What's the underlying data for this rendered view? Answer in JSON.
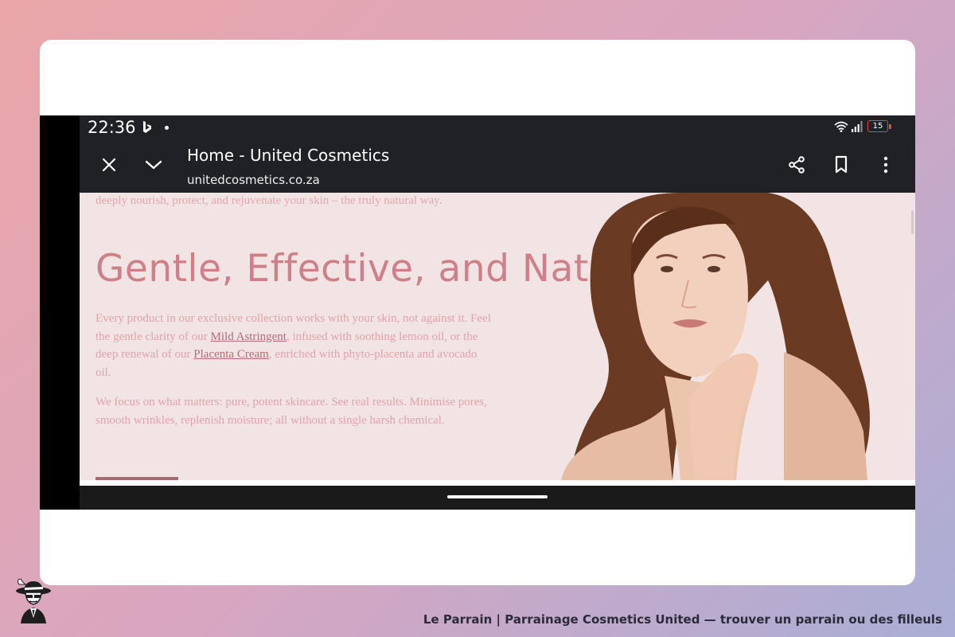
{
  "status_bar": {
    "time": "22:36",
    "battery_level": "15",
    "icons": [
      "bing-icon",
      "notification-dot-icon",
      "wifi-icon",
      "cell-signal-icon",
      "battery-icon"
    ]
  },
  "toolbar": {
    "page_title": "Home - United Cosmetics",
    "url": "unitedcosmetics.co.za",
    "icons": [
      "close-icon",
      "chevron-down-icon",
      "share-icon",
      "bookmark-icon",
      "more-vert-icon"
    ]
  },
  "page": {
    "intro_text": "deeply nourish, protect, and rejuvenate your skin – the truly natural way.",
    "headline": "Gentle, Effective, and Natural",
    "para1": {
      "before_link1": "Every product in our exclusive collection works with your skin, not against it. Feel the gentle clarity of our ",
      "link1": "Mild Astringent",
      "between": ", infused with soothing lemon oil, or the deep renewal of our ",
      "link2": "Placenta Cream",
      "after": ", enriched with phyto-placenta and avocado oil."
    },
    "para2": "We focus on what matters: pure, potent skincare. See real results. Minimise pores, smooth wrinkles, replenish moisture; all without a single harsh chemical."
  },
  "footer": {
    "caption": "Le Parrain | Parrainage Cosmetics United — trouver un parrain ou des filleuls"
  },
  "colors": {
    "headline": "#cd8087",
    "body_text": "#e0a3aa",
    "link": "#b56a74",
    "page_bg": "#f2e4e5",
    "toolbar_bg": "#1f2124",
    "battery_low": "#e04a3a"
  }
}
